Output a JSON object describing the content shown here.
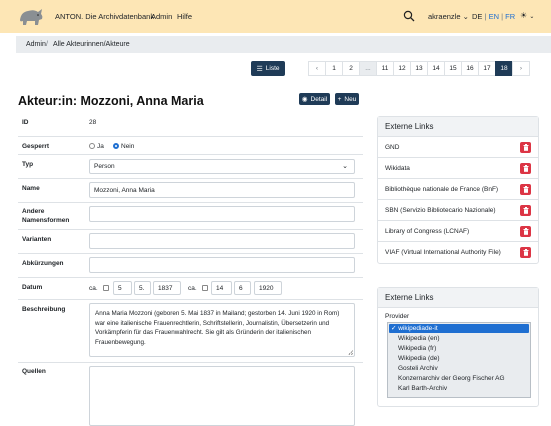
{
  "nav": {
    "brand": "ANTON. Die Archivdatenbank",
    "admin": "Admin",
    "help": "Hilfe",
    "user": "akraenzle",
    "lang_de": "DE",
    "lang_en": "EN",
    "lang_fr": "FR",
    "sep": "|"
  },
  "breadcrumb": {
    "root": "Admin",
    "sep": "/",
    "current": "Alle Akteurinnen/Akteure"
  },
  "toolbar": {
    "list_label": "Liste",
    "detail_label": "Detail",
    "new_label": "Neu"
  },
  "pagination": {
    "pages": [
      "1",
      "2",
      "...",
      "11",
      "12",
      "13",
      "14",
      "15",
      "16",
      "17",
      "18"
    ],
    "active": "18",
    "prev": "‹",
    "next": "›"
  },
  "title": "Akteur:in: Mozzoni, Anna Maria",
  "form": {
    "id_label": "ID",
    "id_value": "28",
    "gesperrt_label": "Gesperrt",
    "ja": "Ja",
    "nein": "Nein",
    "typ_label": "Typ",
    "typ_value": "Person",
    "name_label": "Name",
    "name_value": "Mozzoni, Anna Maria",
    "andere_label_1": "Andere",
    "andere_label_2": "Namensformen",
    "varianten_label": "Varianten",
    "abk_label": "Abkürzungen",
    "datum_label": "Datum",
    "ca1": "ca.",
    "d1": "5",
    "m1": "5.",
    "y1": "1837",
    "ca2": "ca.",
    "d2": "14",
    "m2": "6",
    "y2": "1920",
    "beschreibung_label": "Beschreibung",
    "beschreibung_value": "Anna Maria Mozzoni (geboren 5. Mai 1837 in Mailand; gestorben 14. Juni 1920 in Rom) war eine italienische Frauenrechtlerin, Schriftstellerin, Journalistin, Übersetzerin und Vorkämpferin für das Frauenwahlrecht. Sie gilt als Gründerin der italienischen Frauenbewegung.",
    "quellen_label": "Quellen"
  },
  "links_card": {
    "title": "Externe Links",
    "items": [
      "GND",
      "Wikidata",
      "Bibliothèque nationale de France (BnF)",
      "SBN (Servizio Bibliotecario Nazionale)",
      "Library of Congress (LCNAF)",
      "VIAF (Virtual International Authority File)"
    ]
  },
  "add_card": {
    "title": "Externe Links",
    "provider_label": "Provider",
    "options": [
      "wikipediade-it",
      "Wikipedia (en)",
      "Wikipedia (fr)",
      "Wikipedia (de)",
      "Gosteli Archiv",
      "Konzernarchiv der Georg Fischer AG",
      "Karl Barth-Archiv"
    ],
    "selected_mark": "✓"
  },
  "colors": {
    "topbar": "#fde6b5",
    "primary_dark": "#1f3b57",
    "danger": "#dc3545",
    "selected": "#1f6fd1"
  }
}
